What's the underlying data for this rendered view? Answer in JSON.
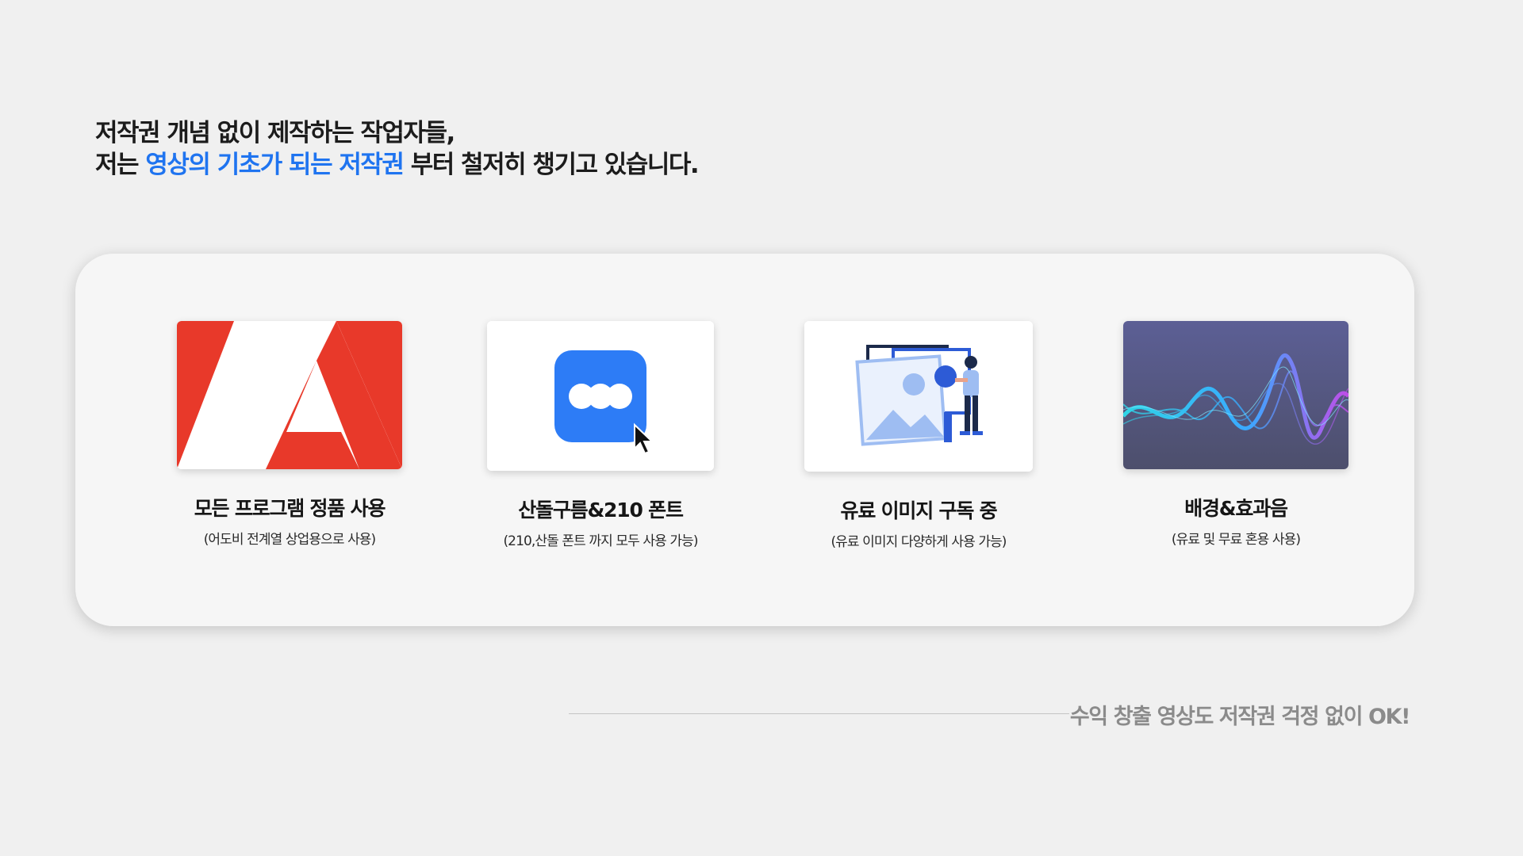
{
  "headline": {
    "line1": "저작권 개념 없이 제작하는 작업자들,",
    "line2_prefix": "저는 ",
    "line2_accent": "영상의 기초가 되는 저작권",
    "line2_suffix": " 부터 철저히 챙기고 있습니다."
  },
  "features": [
    {
      "icon": "adobe-logo-icon",
      "title": "모든 프로그램 정품 사용",
      "desc": "(어도비 전계열 상업용으로 사용)"
    },
    {
      "icon": "font-app-icon",
      "title": "산돌구름&210 폰트",
      "desc": "(210,산돌 폰트 까지 모두 사용 가능)"
    },
    {
      "icon": "image-library-illustration-icon",
      "title": "유료 이미지 구독 중",
      "desc": "(유료 이미지 다양하게 사용 가능)"
    },
    {
      "icon": "sound-wave-icon",
      "title": "배경&효과음",
      "desc": "(유료 및 무료 혼용 사용)"
    }
  ],
  "footer": {
    "text": "수익 창출 영상도 저작권 걱정 없이 OK!"
  },
  "colors": {
    "accent": "#1f74f0",
    "adobe_red": "#e8392a",
    "app_blue": "#2d7cf6",
    "background": "#f0f0f0",
    "panel": "#f6f6f6"
  }
}
